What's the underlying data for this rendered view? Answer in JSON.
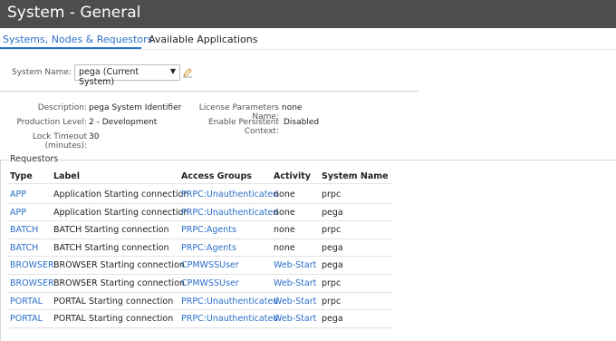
{
  "window": {
    "title": "System - General"
  },
  "tabs": [
    {
      "label": "Systems, Nodes & Requestors",
      "active": true
    },
    {
      "label": "Available Applications",
      "active": false
    }
  ],
  "system_name": {
    "label": "System Name:",
    "value": "pega (Current System)"
  },
  "details": {
    "description": {
      "label": "Description:",
      "value": "pega System Identifier"
    },
    "production_level": {
      "label": "Production Level:",
      "value": "2 - Development"
    },
    "lock_timeout": {
      "label": "Lock Timeout (minutes):",
      "value": "30"
    },
    "license_params": {
      "label": "License Parameters Name:",
      "value": "none"
    },
    "persistent_context": {
      "label": "Enable Persistent Context:",
      "value": "Disabled"
    }
  },
  "requestors": {
    "title": "Requestors",
    "columns": [
      "Type",
      "Label",
      "Access Groups",
      "Activity",
      "System Name"
    ],
    "rows": [
      [
        "APP",
        "Application Starting connection",
        "PRPC:Unauthenticated",
        "none",
        "prpc"
      ],
      [
        "APP",
        "Application Starting connection",
        "PRPC:Unauthenticated",
        "none",
        "pega"
      ],
      [
        "BATCH",
        "BATCH Starting connection",
        "PRPC:Agents",
        "none",
        "prpc"
      ],
      [
        "BATCH",
        "BATCH Starting connection",
        "PRPC:Agents",
        "none",
        "pega"
      ],
      [
        "BROWSER",
        "BROWSER Starting connection",
        "CPMWSSUser",
        "Web-Start",
        "pega"
      ],
      [
        "BROWSER",
        "BROWSER Starting connection",
        "CPMWSSUser",
        "Web-Start",
        "prpc"
      ],
      [
        "PORTAL",
        "PORTAL Starting connection",
        "PRPC:Unauthenticated",
        "Web-Start",
        "prpc"
      ],
      [
        "PORTAL",
        "PORTAL Starting connection",
        "PRPC:Unauthenticated",
        "Web-Start",
        "pega"
      ]
    ]
  },
  "colors": {
    "titlebar": "#4d4d4d",
    "link": "#2a6fc9"
  }
}
